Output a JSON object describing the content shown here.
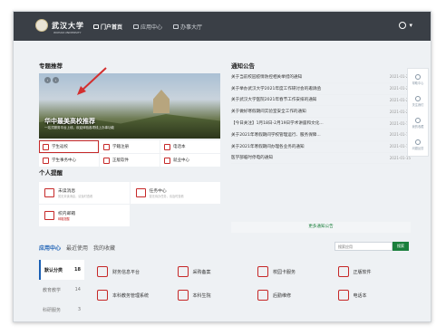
{
  "header": {
    "logo_text": "武汉大学",
    "logo_sub": "WUHAN UNIVERSITY",
    "nav": [
      {
        "label": "门户首页",
        "active": true
      },
      {
        "label": "应用中心",
        "active": false
      },
      {
        "label": "办事大厅",
        "active": false
      }
    ],
    "user_caret": "▾"
  },
  "featured": {
    "title": "专题推荐",
    "banner_title": "华中最美高校推荐",
    "banner_sub": "一站式服务平台上线，欢迎体验各项线上办事功能",
    "arrows": [
      "‹",
      "›"
    ],
    "tiles": [
      {
        "label": "学生返校"
      },
      {
        "label": "学籍注册"
      },
      {
        "label": "电话本"
      },
      {
        "label": "学生事务中心"
      },
      {
        "label": "正版软件"
      },
      {
        "label": "就业中心"
      }
    ]
  },
  "notice": {
    "title": "通知公告",
    "items": [
      {
        "text": "关于当前校园疫情防控相关举措的通知",
        "date": "2021-01-21"
      },
      {
        "text": "关于举办武汉大学2021年度工作研讨会的邀请函",
        "date": "2021-01-21"
      },
      {
        "text": "关于武汉大学医院2021年春节工作安排的通知",
        "date": "2021-01-20"
      },
      {
        "text": "关于做好寒假期间实验室安全工作的通知",
        "date": "2021-01-20"
      },
      {
        "text": "【今日关注】1月18日-2月19日学术讲座和文化...",
        "date": "2021-01-18"
      },
      {
        "text": "关于2021年寒假期间学校管理运行、服务保障...",
        "date": "2021-01-18"
      },
      {
        "text": "关于2021年寒假期间办理各业务的通知",
        "date": "2021-01-15"
      },
      {
        "text": "医学部临时停电的通知",
        "date": "2021-01-15"
      }
    ],
    "more": "更多通知公告"
  },
  "reminder": {
    "title": "个人提醒",
    "items": [
      {
        "title": "未读消息",
        "sub": "暂无未读消息，请及时查看"
      },
      {
        "title": "任务中心",
        "sub": "暂无待办任务，请及时查看"
      },
      {
        "title": "校内邮箱",
        "sub": "邮箱提醒"
      }
    ]
  },
  "apps": {
    "tabs": [
      {
        "label": "应用中心",
        "active": true
      },
      {
        "label": "最近使用",
        "active": false
      },
      {
        "label": "我的收藏",
        "active": false
      }
    ],
    "search_placeholder": "搜索应用",
    "search_button": "搜索",
    "categories": [
      {
        "label": "默认分类",
        "count": "18",
        "active": true
      },
      {
        "label": "教育教学",
        "count": "14",
        "active": false
      },
      {
        "label": "科研服务",
        "count": "3",
        "active": false
      }
    ],
    "items": [
      {
        "label": "财务信息平台"
      },
      {
        "label": "采购备案"
      },
      {
        "label": "校园卡服务"
      },
      {
        "label": "正版软件"
      },
      {
        "label": "本科教务管理系统"
      },
      {
        "label": "本科生院"
      },
      {
        "label": "后勤维修"
      },
      {
        "label": "电话本"
      }
    ]
  },
  "rail": {
    "items": [
      {
        "label": "帮助中心",
        "icon": "eye-icon"
      },
      {
        "label": "关注我们",
        "icon": "grid-icon"
      },
      {
        "label": "我的收藏",
        "icon": "star-icon"
      },
      {
        "label": "问题反馈",
        "icon": "doc-icon"
      }
    ]
  },
  "colors": {
    "topbar": "#3a3f46",
    "accent_red": "#c62828",
    "accent_green": "#1a7f3c",
    "accent_blue": "#1a5fb4"
  }
}
